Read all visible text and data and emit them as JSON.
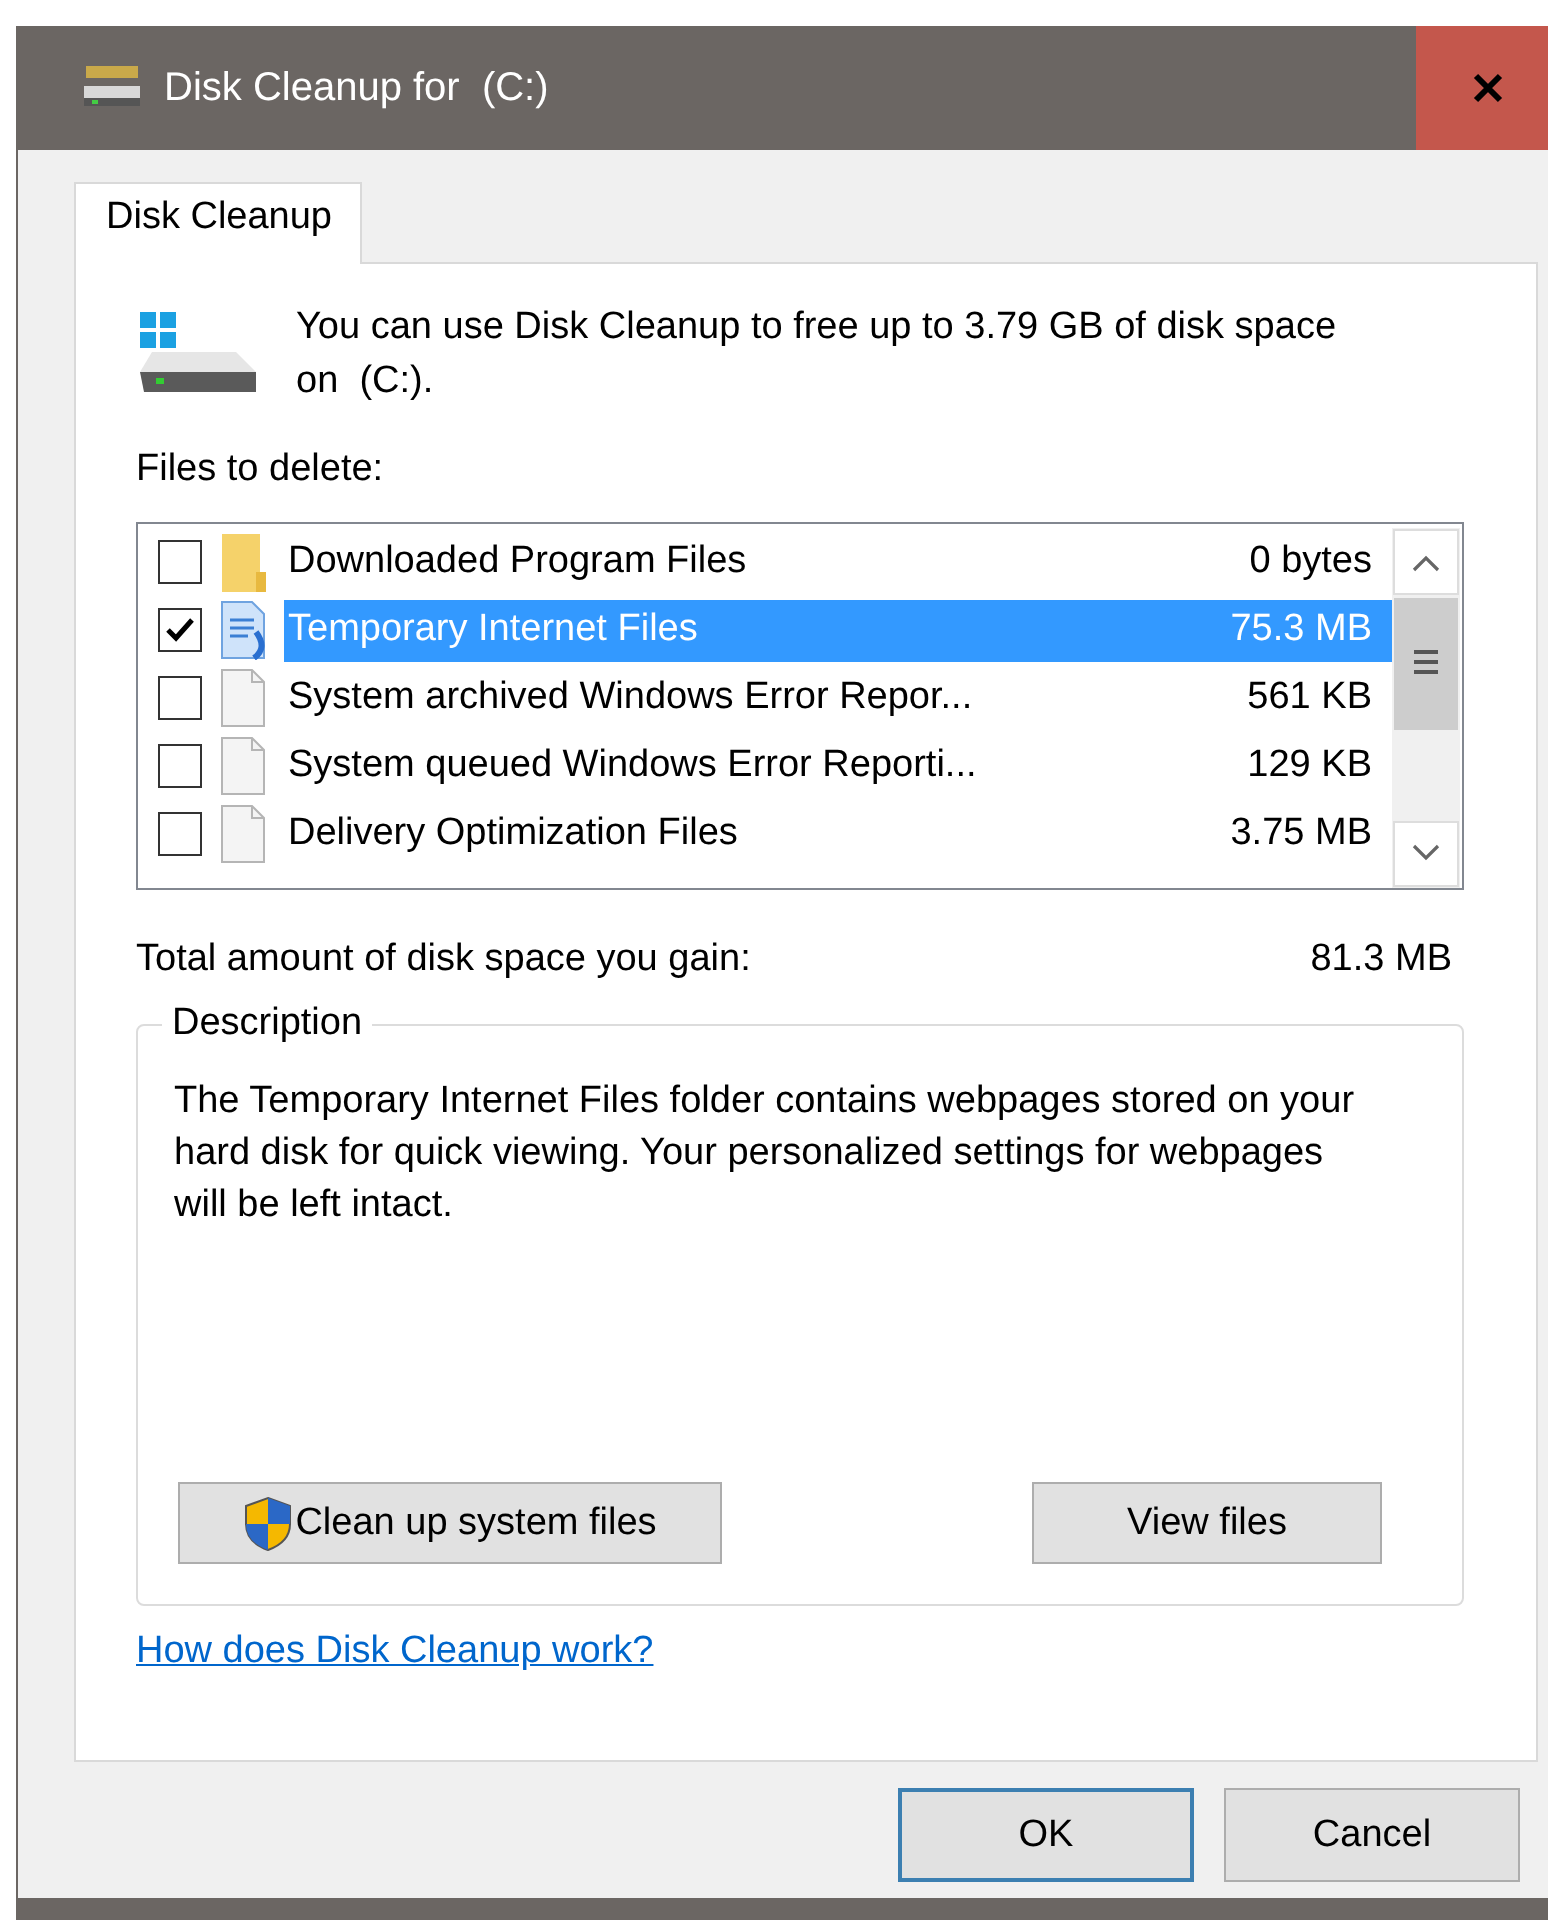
{
  "window": {
    "title": "Disk Cleanup for  (C:)"
  },
  "tabs": [
    {
      "label": "Disk Cleanup",
      "selected": true
    }
  ],
  "intro": "You can use Disk Cleanup to free up to 3.79 GB of disk space on  (C:).",
  "files_label": "Files to delete:",
  "files": [
    {
      "kind": "folder",
      "name": "Downloaded Program Files",
      "size": "0 bytes",
      "checked": false,
      "selected": false
    },
    {
      "kind": "internet",
      "name": "Temporary Internet Files",
      "size": "75.3 MB",
      "checked": true,
      "selected": true
    },
    {
      "kind": "file",
      "name": "System archived Windows Error Repor...",
      "size": "561 KB",
      "checked": false,
      "selected": false
    },
    {
      "kind": "file",
      "name": "System queued Windows Error Reporti...",
      "size": "129 KB",
      "checked": false,
      "selected": false
    },
    {
      "kind": "file",
      "name": "Delivery Optimization Files",
      "size": "3.75 MB",
      "checked": false,
      "selected": false
    }
  ],
  "total": {
    "label": "Total amount of disk space you gain:",
    "value": "81.3 MB"
  },
  "description": {
    "title": "Description",
    "text": "The Temporary Internet Files folder contains webpages stored on your hard disk for quick viewing. Your personalized settings for webpages will be left intact."
  },
  "buttons": [
    {
      "kind": "shield",
      "label": "Clean up system files"
    },
    {
      "kind": "plain",
      "label": "View files"
    }
  ],
  "link": "How does Disk Cleanup work?",
  "dialog_buttons": [
    {
      "label": "OK",
      "default": true
    },
    {
      "label": "Cancel",
      "default": false
    }
  ]
}
